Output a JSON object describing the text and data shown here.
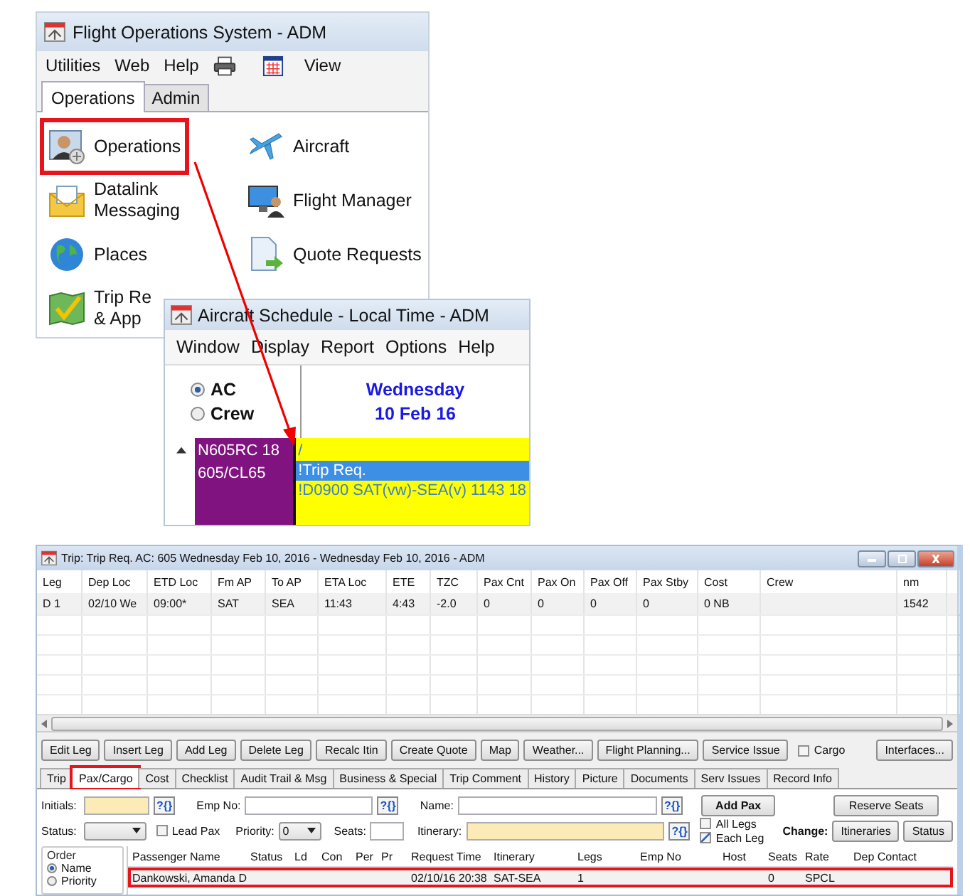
{
  "main_window": {
    "title": "Flight Operations System - ADM",
    "menu": [
      {
        "kind": "text",
        "label": "Utilities"
      },
      {
        "kind": "text",
        "label": "Web"
      },
      {
        "kind": "text",
        "label": "Help"
      },
      {
        "kind": "printer"
      },
      {
        "kind": "calendar"
      },
      {
        "kind": "text",
        "label": "View"
      }
    ],
    "tabs": [
      {
        "label": "Operations",
        "selected": true
      },
      {
        "label": "Admin",
        "selected": false
      }
    ],
    "items": [
      {
        "kind": "person",
        "label": "Operations",
        "highlighted": true
      },
      {
        "kind": "plane",
        "label": "Aircraft",
        "highlighted": false
      },
      {
        "kind": "envelope",
        "label": "Datalink\nMessaging",
        "highlighted": false
      },
      {
        "kind": "monitor",
        "label": "Flight Manager",
        "highlighted": false
      },
      {
        "kind": "globe",
        "label": "Places",
        "highlighted": false
      },
      {
        "kind": "document",
        "label": "Quote Requests",
        "highlighted": false
      },
      {
        "kind": "map",
        "label": "Trip Re\n& App",
        "highlighted": false
      }
    ]
  },
  "schedule_window": {
    "title": "Aircraft Schedule - Local Time - ADM",
    "menu": [
      "Window",
      "Display",
      "Report",
      "Options",
      "Help"
    ],
    "view": [
      {
        "label": "AC",
        "selected": true
      },
      {
        "label": "Crew",
        "selected": false
      }
    ],
    "day": "Wednesday",
    "date": "10 Feb 16",
    "aircraft": [
      "N605RC 18",
      "605/CL65"
    ],
    "lines": [
      {
        "text": "/",
        "selected": false
      },
      {
        "text": "!Trip Req.",
        "selected": true
      },
      {
        "text": "!D0900 SAT(vw)-SEA(v) 1143 18",
        "selected": false
      }
    ]
  },
  "trip_window": {
    "title": "Trip: Trip Req.  AC: 605  Wednesday Feb 10, 2016 - Wednesday Feb 10, 2016 - ADM",
    "legs": {
      "columns": [
        "Leg",
        "Dep Loc",
        "ETD Loc",
        "Fm AP",
        "To AP",
        "ETA Loc",
        "ETE",
        "TZC",
        "Pax Cnt",
        "Pax On",
        "Pax Off",
        "Pax Stby",
        "Cost",
        "Crew",
        "nm"
      ],
      "rows": [
        [
          "D 1",
          "02/10 We",
          "09:00*",
          "SAT",
          "SEA",
          "11:43",
          "4:43",
          "-2.0",
          "0",
          "0",
          "0",
          "0",
          "0 NB",
          null,
          "1542"
        ]
      ]
    },
    "buttons": [
      {
        "kind": "button",
        "label": "Edit Leg"
      },
      {
        "kind": "button",
        "label": "Insert Leg"
      },
      {
        "kind": "button",
        "label": "Add Leg"
      },
      {
        "kind": "button",
        "label": "Delete Leg"
      },
      {
        "kind": "button",
        "label": "Recalc Itin"
      },
      {
        "kind": "button",
        "label": "Create Quote"
      },
      {
        "kind": "button",
        "label": "Map"
      },
      {
        "kind": "button",
        "label": "Weather..."
      },
      {
        "kind": "button",
        "label": "Flight Planning..."
      },
      {
        "kind": "button",
        "label": "Service Issue"
      },
      {
        "kind": "checkbox",
        "label": "Cargo",
        "checked": false
      },
      {
        "kind": "button",
        "label": "Interfaces..."
      }
    ],
    "tabs": [
      {
        "label": "Trip",
        "selected": false,
        "highlighted": false
      },
      {
        "label": "Pax/Cargo",
        "selected": true,
        "highlighted": true
      },
      {
        "label": "Cost",
        "selected": false,
        "highlighted": false
      },
      {
        "label": "Checklist",
        "selected": false,
        "highlighted": false
      },
      {
        "label": "Audit Trail & Msg",
        "selected": false,
        "highlighted": false
      },
      {
        "label": "Business & Special",
        "selected": false,
        "highlighted": false
      },
      {
        "label": "Trip Comment",
        "selected": false,
        "highlighted": false
      },
      {
        "label": "History",
        "selected": false,
        "highlighted": false
      },
      {
        "label": "Picture",
        "selected": false,
        "highlighted": false
      },
      {
        "label": "Documents",
        "selected": false,
        "highlighted": false
      },
      {
        "label": "Serv Issues",
        "selected": false,
        "highlighted": false
      },
      {
        "label": "Record Info",
        "selected": false,
        "highlighted": false
      }
    ],
    "form": {
      "initials_label": "Initials:",
      "empno_label": "Emp No:",
      "name_label": "Name:",
      "lookup": "?{}",
      "add_pax": "Add Pax",
      "reserve_seats": "Reserve Seats",
      "status_label": "Status:",
      "lead_pax": {
        "label": "Lead Pax",
        "checked": false
      },
      "priority_label": "Priority:",
      "priority_value": "0",
      "seats_label": "Seats:",
      "itinerary_label": "Itinerary:",
      "all_legs": {
        "label": "All Legs",
        "checked": false
      },
      "each_leg": {
        "label": "Each Leg",
        "checked": true
      },
      "change_label": "Change:",
      "itineraries": "Itineraries",
      "status_button": "Status"
    },
    "order": {
      "title": "Order",
      "options": [
        {
          "label": "Name",
          "selected": true
        },
        {
          "label": "Priority",
          "selected": false
        }
      ]
    },
    "pax": {
      "columns": [
        "Passenger Name",
        "Status",
        "Ld",
        "Con",
        "Per",
        "Pr",
        "Request Time",
        "Itinerary",
        "Legs",
        "Emp No",
        "Host",
        "Seats",
        "Rate",
        "Dep Contact"
      ],
      "rows": [
        {
          "highlighted": true,
          "cells": [
            "Dankowski, Amanda D",
            null,
            null,
            null,
            null,
            null,
            "02/10/16 20:38",
            "SAT-SEA",
            "1",
            null,
            null,
            "0",
            "SPCL",
            null
          ]
        }
      ]
    }
  }
}
